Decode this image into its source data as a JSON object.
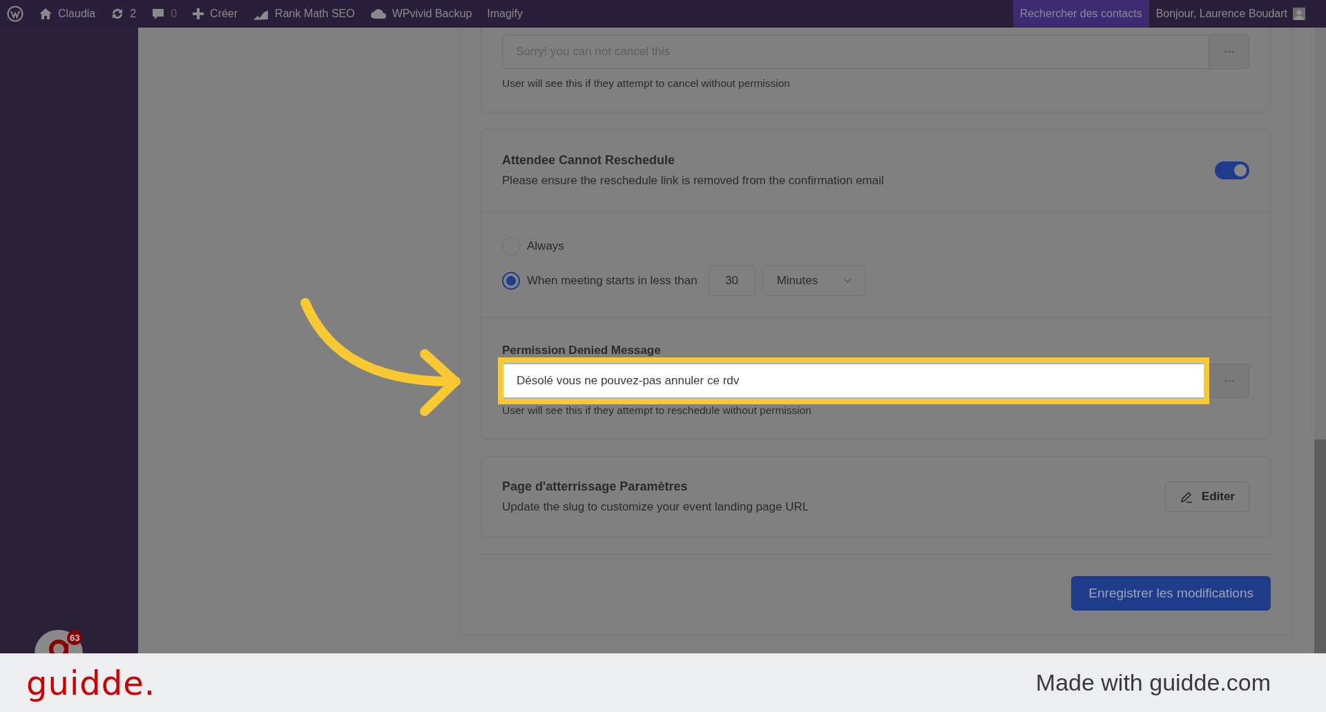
{
  "admin_bar": {
    "items": [
      {
        "kind": "logo"
      },
      {
        "kind": "home",
        "label": "Claudia"
      },
      {
        "kind": "updates",
        "label": "2"
      },
      {
        "kind": "comments",
        "label": "0"
      },
      {
        "kind": "new",
        "label": "Créer"
      },
      {
        "kind": "chart",
        "label": "Rank Math SEO"
      },
      {
        "kind": "cloud",
        "label": "WPvivid Backup"
      },
      {
        "kind": "text",
        "label": "Imagify"
      }
    ],
    "search_contacts": "Rechercher des contacts",
    "greeting": "Bonjour, Laurence Boudart"
  },
  "sidebar": {
    "badge_count": "63"
  },
  "cancel_message": {
    "value": "Sorry! you can not cancel this",
    "help": "User will see this if they attempt to cancel without permission"
  },
  "reschedule": {
    "title": "Attendee Cannot Reschedule",
    "description": "Please ensure the reschedule link is removed from the confirmation email",
    "on": true,
    "options": [
      {
        "label": "Always",
        "selected": false
      },
      {
        "label": "When meeting starts in less than",
        "selected": true
      }
    ],
    "amount": "30",
    "unit": "Minutes"
  },
  "permission": {
    "label": "Permission Denied Message",
    "value": "Désolé vous ne pouvez-pas annuler ce rdv",
    "help": "User will see this if they attempt to reschedule without permission"
  },
  "landing": {
    "title": "Page d'atterrissage Paramètres",
    "description": "Update the slug to customize your event landing page URL",
    "edit_button": "Editer"
  },
  "save_button": "Enregistrer les modifications",
  "footer": {
    "brand": "guidde.",
    "credit": "Made with guidde.com"
  }
}
